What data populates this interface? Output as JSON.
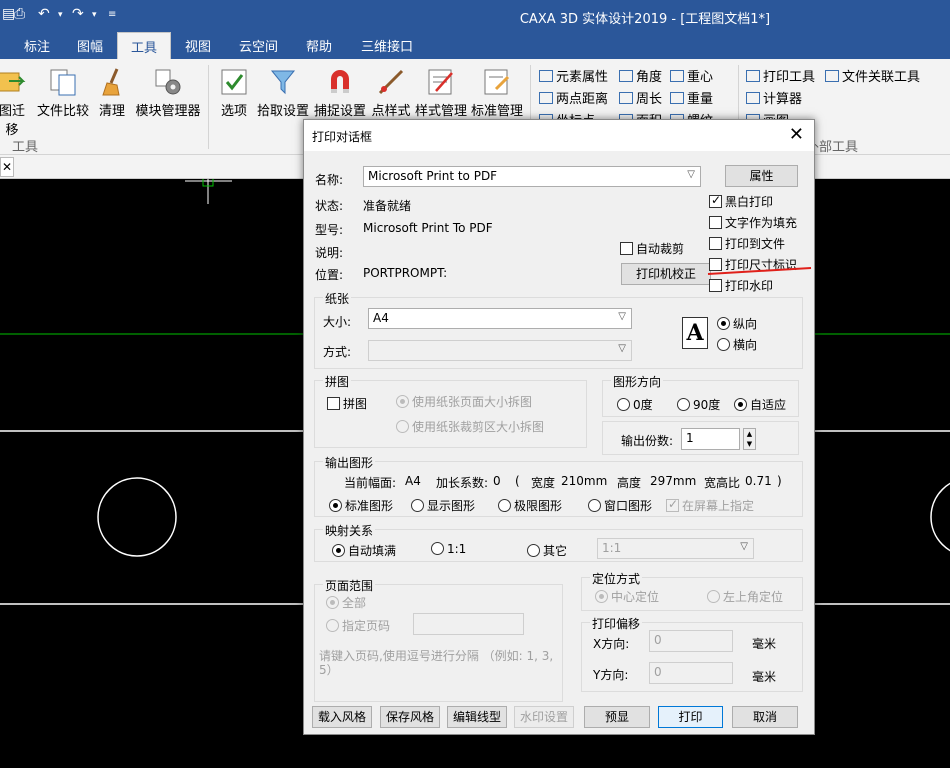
{
  "app": {
    "title": "CAXA 3D 实体设计2019 - [工程图文档1*]",
    "colors": {
      "ribbon_blue": "#2b579a",
      "annotation_red": "#e0201a",
      "drawing_white": "#ffffff",
      "drawing_green": "#00c000"
    }
  },
  "tabs": [
    "标注",
    "图幅",
    "工具",
    "视图",
    "云空间",
    "帮助",
    "三维接口"
  ],
  "ribbon": {
    "large_buttons": [
      "图迁移",
      "文件比较",
      "清理",
      "模块管理器",
      "选项",
      "拾取设置",
      "捕捉设置",
      "点样式",
      "样式管理",
      "标准管理"
    ],
    "small_buttons": [
      "元素属性",
      "角度",
      "重心",
      "两点距离",
      "周长",
      "重量",
      "坐标点",
      "面积",
      "螺纹",
      "打印工具",
      "文件关联工具",
      "计算器",
      "画图"
    ],
    "groups": [
      "工具",
      "外部工具"
    ]
  },
  "dialog": {
    "title": "打印对话框",
    "name_label": "名称:",
    "printer": "Microsoft Print to PDF",
    "status_label": "状态:",
    "status": "准备就绪",
    "type_label": "型号:",
    "type": "Microsoft Print To PDF",
    "desc_label": "说明:",
    "location_label": "位置:",
    "location": "PORTPROMPT:",
    "auto_crop": "自动裁剪",
    "properties_btn": "属性",
    "calibrate_btn": "打印机校正",
    "options": [
      {
        "label": "黑白打印",
        "checked": true
      },
      {
        "label": "文字作为填充",
        "checked": false
      },
      {
        "label": "打印到文件",
        "checked": false
      },
      {
        "label": "打印尺寸标识",
        "checked": false
      },
      {
        "label": "打印水印",
        "checked": false
      }
    ],
    "paper": {
      "legend": "纸张",
      "size_label": "大小:",
      "size": "A4",
      "source_label": "方式:",
      "source": "",
      "orientation_icon": "A",
      "portrait": "纵向",
      "landscape": "横向",
      "orientation": "portrait"
    },
    "tile": {
      "legend": "拼图",
      "enable": "拼图",
      "by_page": "使用纸张页面大小拆图",
      "by_crop": "使用纸张裁剪区大小拆图"
    },
    "direction": {
      "legend": "图形方向",
      "d0": "0度",
      "d90": "90度",
      "auto": "自适应",
      "selected": "auto"
    },
    "copies_label": "输出份数:",
    "copies": "1",
    "output": {
      "legend": "输出图形",
      "current_label": "当前幅面:",
      "current": "A4",
      "ext_label": "加长系数:",
      "ext": "0",
      "open_paren": "(",
      "width_label": "宽度",
      "width": "210mm",
      "height_label": "高度",
      "height": "297mm",
      "ratio_label": "宽高比",
      "ratio": "0.71",
      "close_paren": ")",
      "standard": "标准图形",
      "display": "显示图形",
      "limit": "极限图形",
      "window": "窗口图形",
      "on_screen": "在屏幕上指定"
    },
    "mapping": {
      "legend": "映射关系",
      "auto_fill": "自动填满",
      "one_to_one": "1:1",
      "other": "其它",
      "other_value": "1:1"
    },
    "page_range": {
      "legend": "页面范围",
      "all": "全部",
      "specify": "指定页码",
      "hint": "请键入页码,使用逗号进行分隔 （例如: 1, 3, 5）"
    },
    "position": {
      "legend": "定位方式",
      "center": "中心定位",
      "top_left": "左上角定位"
    },
    "offset": {
      "legend": "打印偏移",
      "x_label": "X方向:",
      "x": "0",
      "y_label": "Y方向:",
      "y": "0",
      "unit": "毫米"
    },
    "buttons": {
      "load_style": "载入风格",
      "save_style": "保存风格",
      "edit_linetype": "编辑线型",
      "watermark": "水印设置",
      "preview": "预显",
      "print": "打印",
      "cancel": "取消"
    }
  }
}
